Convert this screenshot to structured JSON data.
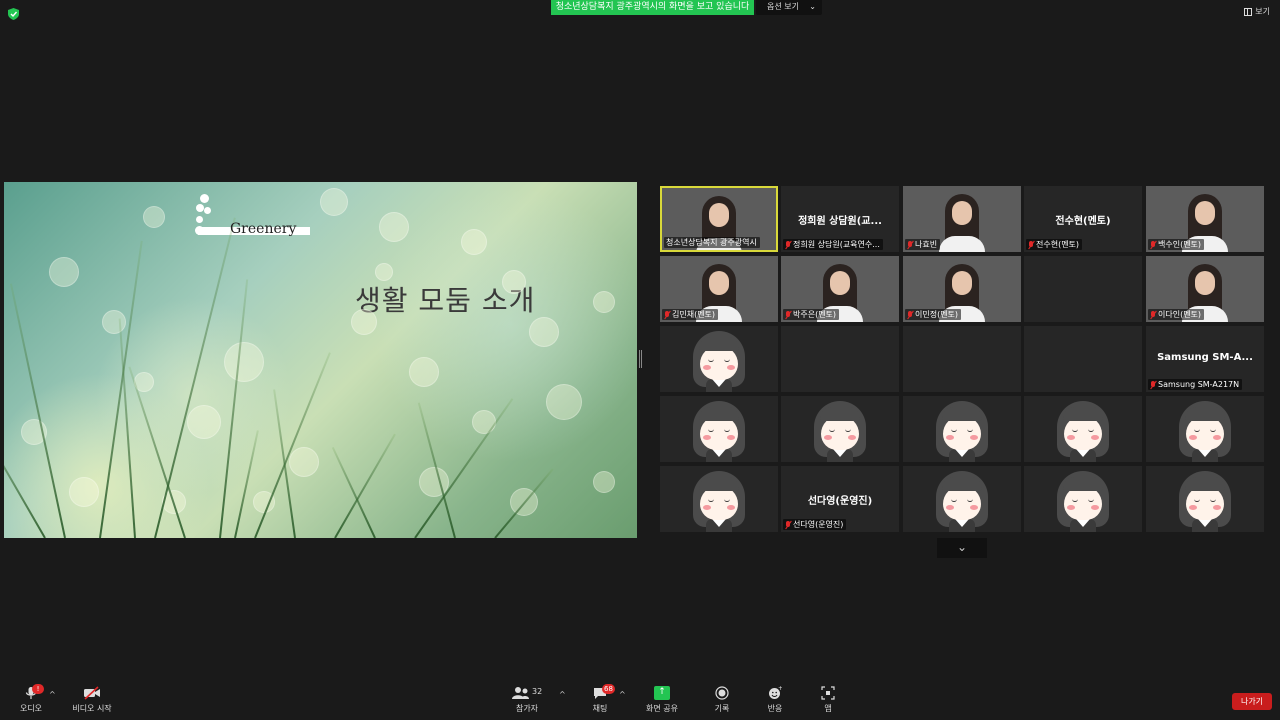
{
  "top_bar": {
    "share_banner": "청소년상담복지 광주광역시의 화면을 보고 있습니다",
    "view_options_label": "옵션 보기",
    "view_button_label": "보기"
  },
  "slide": {
    "brand": "Greenery",
    "title": "생활 모둠 소개"
  },
  "gallery": {
    "tiles": [
      {
        "name": "청소년상담복지 광주광역시",
        "type": "camera",
        "active": true,
        "muted": false
      },
      {
        "name": "정희원 상담원(교육연수...",
        "center_name": "정희원 상담원(교...",
        "type": "name",
        "muted": true
      },
      {
        "name": "나효빈",
        "type": "camera",
        "muted": true
      },
      {
        "name": "전수현(멘토)",
        "center_name": "전수현(멘토)",
        "type": "name",
        "muted": true
      },
      {
        "name": "백수인(멘토)",
        "type": "camera",
        "muted": true
      },
      {
        "name": "김민채(멘토)",
        "type": "camera",
        "muted": true
      },
      {
        "name": "박주은(멘토)",
        "type": "camera",
        "muted": true
      },
      {
        "name": "이민정(멘토)",
        "type": "camera",
        "muted": true
      },
      {
        "name": "",
        "type": "empty"
      },
      {
        "name": "이다인(멘토)",
        "type": "camera",
        "muted": true
      },
      {
        "name": "",
        "type": "avatar"
      },
      {
        "name": "",
        "type": "empty"
      },
      {
        "name": "",
        "type": "empty"
      },
      {
        "name": "",
        "type": "empty"
      },
      {
        "name": "Samsung SM-A217N",
        "center_name": "Samsung  SM-A...",
        "type": "name",
        "muted": true
      },
      {
        "name": "",
        "type": "avatar"
      },
      {
        "name": "",
        "type": "avatar"
      },
      {
        "name": "",
        "type": "avatar"
      },
      {
        "name": "",
        "type": "avatar"
      },
      {
        "name": "",
        "type": "avatar"
      },
      {
        "name": "",
        "type": "avatar"
      },
      {
        "name": "선다영(운영진)",
        "center_name": "선다영(운영진)",
        "type": "name",
        "muted": true
      },
      {
        "name": "",
        "type": "avatar"
      },
      {
        "name": "",
        "type": "avatar"
      },
      {
        "name": "",
        "type": "avatar"
      }
    ]
  },
  "toolbar": {
    "audio_label": "오디오",
    "audio_badge": "!",
    "video_label": "비디오 시작",
    "participants_label": "참가자",
    "participants_count": "32",
    "chat_label": "채팅",
    "chat_badge": "68",
    "share_label": "화면 공유",
    "record_label": "기록",
    "reactions_label": "반응",
    "apps_label": "앱",
    "leave_label": "나가기"
  },
  "colors": {
    "share_green": "#23c552",
    "leave_red": "#c91d1d",
    "active_border": "#d9d93a",
    "mute_red": "#e02828"
  }
}
